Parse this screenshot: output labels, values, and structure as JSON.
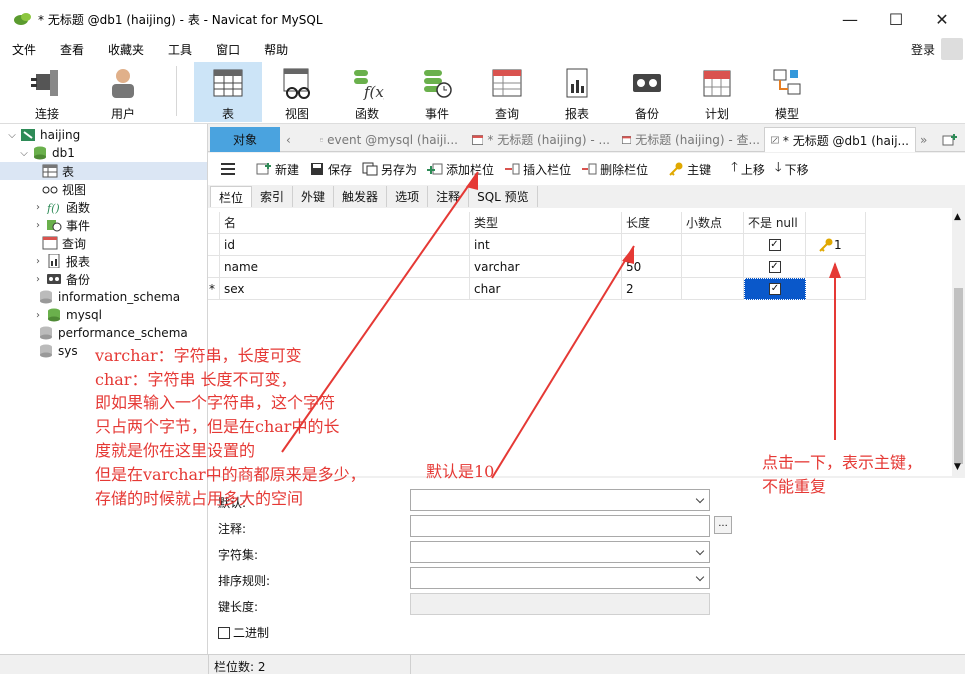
{
  "window": {
    "title": "* 无标题 @db1 (haijing) - 表 - Navicat for MySQL",
    "controls": [
      "—",
      "☐",
      "✕"
    ]
  },
  "menu": [
    "文件",
    "查看",
    "收藏夹",
    "工具",
    "窗口",
    "帮助"
  ],
  "login": "登录",
  "toolbar": [
    {
      "label": "连接",
      "icon": "plug-icon"
    },
    {
      "label": "用户",
      "icon": "user-icon"
    },
    {
      "label": "表",
      "icon": "table-icon"
    },
    {
      "label": "视图",
      "icon": "view-icon"
    },
    {
      "label": "函数",
      "icon": "function-icon"
    },
    {
      "label": "事件",
      "icon": "event-icon"
    },
    {
      "label": "查询",
      "icon": "query-icon"
    },
    {
      "label": "报表",
      "icon": "report-icon"
    },
    {
      "label": "备份",
      "icon": "backup-icon"
    },
    {
      "label": "计划",
      "icon": "schedule-icon"
    },
    {
      "label": "模型",
      "icon": "model-icon"
    }
  ],
  "tree": [
    {
      "label": "haijing",
      "twisty": "⌵"
    },
    {
      "label": "db1",
      "twisty": "⌵"
    },
    {
      "label": "表",
      "twisty": ""
    },
    {
      "label": "视图",
      "twisty": ""
    },
    {
      "label": "函数",
      "twisty": "›"
    },
    {
      "label": "事件",
      "twisty": "›"
    },
    {
      "label": "查询",
      "twisty": ""
    },
    {
      "label": "报表",
      "twisty": "›"
    },
    {
      "label": "备份",
      "twisty": "›"
    },
    {
      "label": "information_schema",
      "twisty": ""
    },
    {
      "label": "mysql",
      "twisty": "›"
    },
    {
      "label": "performance_schema",
      "twisty": ""
    },
    {
      "label": "sys",
      "twisty": ""
    }
  ],
  "tabs": {
    "objects": "对象",
    "items": [
      "event @mysql (haiji...",
      "* 无标题 (haijing) - ...",
      "无标题 (haijing) - 查...",
      "* 无标题 @db1 (haij..."
    ]
  },
  "actions": [
    "新建",
    "保存",
    "另存为",
    "添加栏位",
    "插入栏位",
    "删除栏位",
    "主键",
    "上移",
    "下移"
  ],
  "field_tabs": [
    "栏位",
    "索引",
    "外键",
    "触发器",
    "选项",
    "注释",
    "SQL 预览"
  ],
  "columns": [
    "名",
    "类型",
    "长度",
    "小数点",
    "不是 null"
  ],
  "rows": [
    {
      "marker": "",
      "name": "id",
      "type": "int",
      "length": "",
      "decimals": "",
      "not_null": true,
      "key": "1"
    },
    {
      "marker": "",
      "name": "name",
      "type": "varchar",
      "length": "50",
      "decimals": "",
      "not_null": true,
      "key": ""
    },
    {
      "marker": "*",
      "name": "sex",
      "type": "char",
      "length": "2",
      "decimals": "",
      "not_null": true,
      "key": ""
    }
  ],
  "props": {
    "default": "默认:",
    "comment": "注释:",
    "charset": "字符集:",
    "collation": "排序规则:",
    "key_length": "键长度:",
    "binary": "二进制",
    "ellipsis": "..."
  },
  "status": "栏位数: 2",
  "annotations": {
    "left": [
      "varchar：字符串，长度可变",
      "char：字符串  长度不可变，",
      "即如果输入一个字符串，这个字符",
      "只占两个字节，但是在char中的长",
      "度就是你在这里设置的",
      "但是在varchar中的商都原来是多少，",
      "存储的时候就占用多大的空间"
    ],
    "middle": "默认是10",
    "right": [
      "点击一下，表示主键，",
      "不能重复"
    ]
  }
}
